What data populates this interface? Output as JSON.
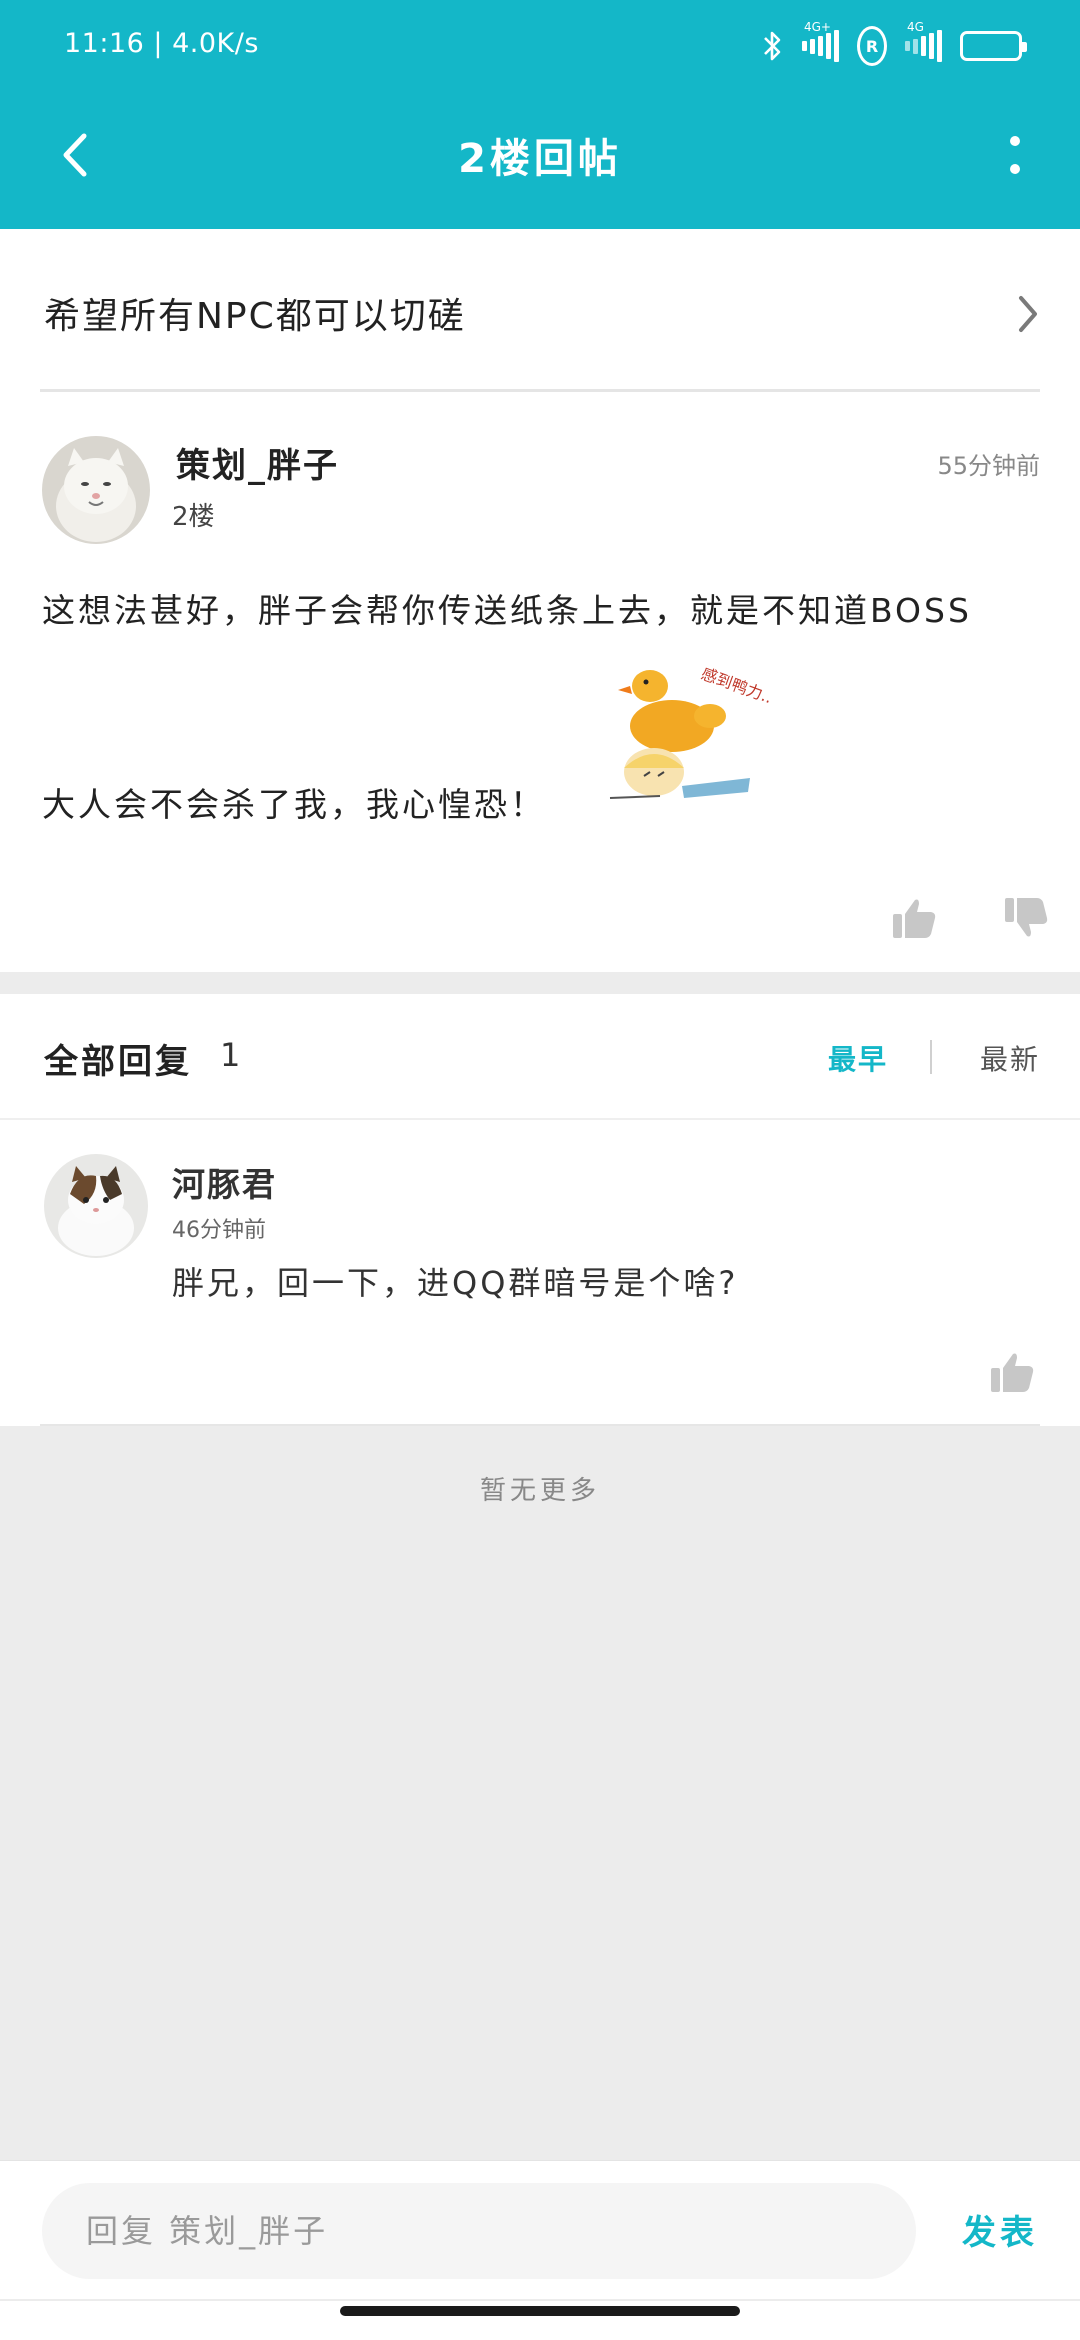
{
  "status_bar": {
    "time": "11:16",
    "speed": "4.0K/s",
    "net1": "4G+",
    "net2": "4G",
    "roaming": "R",
    "battery_color": "#4bd964"
  },
  "header": {
    "title": "2楼回帖",
    "back_icon": "back-arrow-icon",
    "more_icon": "more-vertical-icon",
    "bg_color": "#14b7c8"
  },
  "topic": {
    "title": "希望所有NPC都可以切磋"
  },
  "post": {
    "author": "策划_胖子",
    "floor": "2楼",
    "time": "55分钟前",
    "text_line1": "这想法甚好，胖子会帮你传送纸条上去，就是不知道BOSS",
    "text_line2": "大人会不会杀了我，我心惶恐！",
    "sticker_text": "感到鸭力..."
  },
  "replies": {
    "title": "全部回复",
    "count": "1",
    "sort_earliest": "最早",
    "sort_latest": "最新",
    "items": [
      {
        "author": "河豚君",
        "time": "46分钟前",
        "text": "胖兄，回一下，进QQ群暗号是个啥?"
      }
    ]
  },
  "footer": {
    "no_more": "暂无更多",
    "reply_placeholder": "回复 策划_胖子",
    "publish": "发表"
  }
}
